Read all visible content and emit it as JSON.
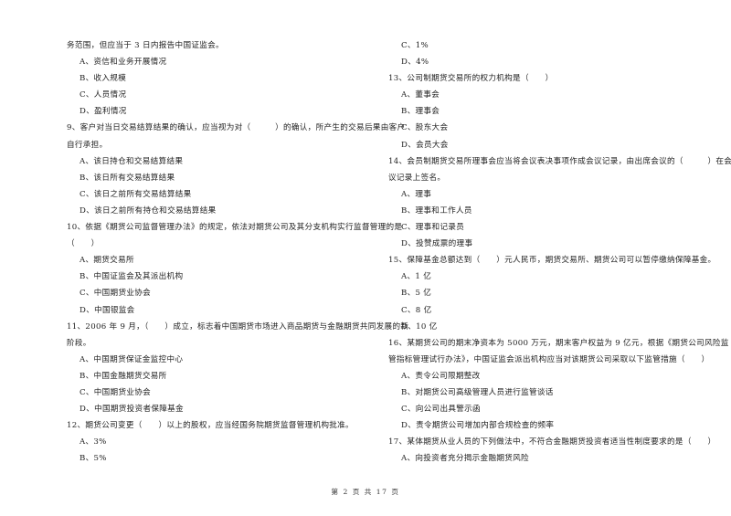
{
  "left_column": [
    {
      "type": "text",
      "text": "务范围，但应当于 3 日内报告中国证监会。"
    },
    {
      "type": "option",
      "text": "A、资信和业务开展情况"
    },
    {
      "type": "option",
      "text": "B、收入规模"
    },
    {
      "type": "option",
      "text": "C、人员情况"
    },
    {
      "type": "option",
      "text": "D、盈利情况"
    },
    {
      "type": "text",
      "text": "9、客户对当日交易结算结果的确认，应当视为对（　　　）的确认，所产生的交易后果由客户"
    },
    {
      "type": "text",
      "text": "自行承担。"
    },
    {
      "type": "option",
      "text": "A、该日持仓和交易结算结果"
    },
    {
      "type": "option",
      "text": "B、该日所有交易结算结果"
    },
    {
      "type": "option",
      "text": "C、该日之前所有交易结算结果"
    },
    {
      "type": "option",
      "text": "D、该日之前所有持仓和交易结算结果"
    },
    {
      "type": "text",
      "text": "10、依据《期货公司监督管理办法》的规定，依法对期货公司及其分支机构实行监督管理的是"
    },
    {
      "type": "text",
      "text": "（　　）"
    },
    {
      "type": "option",
      "text": "A、期货交易所"
    },
    {
      "type": "option",
      "text": "B、中国证监会及其派出机构"
    },
    {
      "type": "option",
      "text": "C、中国期货业协会"
    },
    {
      "type": "option",
      "text": "D、中国银监会"
    },
    {
      "type": "text",
      "text": "11、2006 年 9 月，（　　）成立，标志着中国期货市场进入商品期货与金融期货共同发展的新"
    },
    {
      "type": "text",
      "text": "阶段。"
    },
    {
      "type": "option",
      "text": "A、中国期货保证金监控中心"
    },
    {
      "type": "option",
      "text": "B、中国金融期货交易所"
    },
    {
      "type": "option",
      "text": "C、中国期货业协会"
    },
    {
      "type": "option",
      "text": "D、中国期货投资者保障基金"
    },
    {
      "type": "text",
      "text": "12、期货公司变更（　　）以上的股权，应当经国务院期货监督管理机构批准。"
    },
    {
      "type": "option",
      "text": "A、3%"
    },
    {
      "type": "option",
      "text": "B、5%"
    }
  ],
  "right_column": [
    {
      "type": "option",
      "text": "C、1%"
    },
    {
      "type": "option",
      "text": "D、4%"
    },
    {
      "type": "text",
      "text": "13、公司制期货交易所的权力机构是（　　）"
    },
    {
      "type": "option",
      "text": "A、董事会"
    },
    {
      "type": "option",
      "text": "B、理事会"
    },
    {
      "type": "option",
      "text": "C、股东大会"
    },
    {
      "type": "option",
      "text": "D、会员大会"
    },
    {
      "type": "text",
      "text": "14、会员制期货交易所理事会应当将会议表决事项作成会议记录，由出席会议的（　　　）在会"
    },
    {
      "type": "text",
      "text": "议记录上签名。"
    },
    {
      "type": "option",
      "text": "A、理事"
    },
    {
      "type": "option",
      "text": "B、理事和工作人员"
    },
    {
      "type": "option",
      "text": "C、理事和记录员"
    },
    {
      "type": "option",
      "text": "D、投赞成票的理事"
    },
    {
      "type": "text",
      "text": "15、保障基金总额达到（　　）元人民币，期货交易所、期货公司可以暂停缴纳保障基金。"
    },
    {
      "type": "option",
      "text": "A、1 亿"
    },
    {
      "type": "option",
      "text": "B、5 亿"
    },
    {
      "type": "option",
      "text": "C、8 亿"
    },
    {
      "type": "option",
      "text": "D、10 亿"
    },
    {
      "type": "text",
      "text": "16、某期货公司的期末净资本为 5000 万元，期末客户权益为 9 亿元，根据《期货公司风险监"
    },
    {
      "type": "text",
      "text": "管指标管理试行办法》，中国证监会派出机构应当对该期货公司采取以下监管措施（　　）"
    },
    {
      "type": "option",
      "text": "A、责令公司限期整改"
    },
    {
      "type": "option",
      "text": "B、对期货公司高级管理人员进行监管谈话"
    },
    {
      "type": "option",
      "text": "C、向公司出具警示函"
    },
    {
      "type": "option",
      "text": "D、责令期货公司增加内部合规检查的频率"
    },
    {
      "type": "text",
      "text": "17、某体期货从业人员的下列做法中，不符合金融期货投资者适当性制度要求的是（　　）"
    },
    {
      "type": "option",
      "text": "A、向投资者充分揭示金融期货风险"
    }
  ],
  "footer": {
    "page_label": "第 2 页 共 17 页"
  }
}
